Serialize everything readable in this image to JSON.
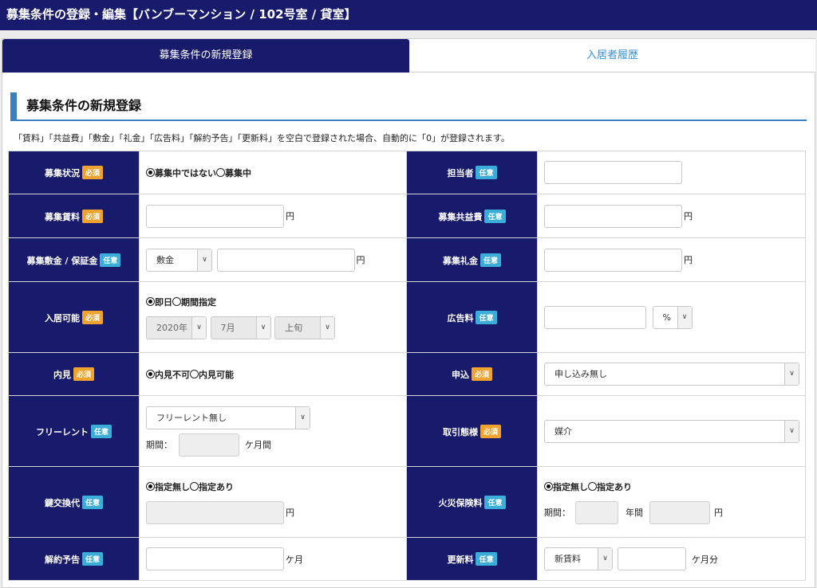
{
  "header": {
    "title": "募集条件の登録・編集【バンブーマンション / 102号室 / 貸室】"
  },
  "tabs": [
    {
      "label": "募集条件の新規登録"
    },
    {
      "label": "入居者履歴"
    }
  ],
  "section": {
    "title": "募集条件の新規登録",
    "note": "「賃料」「共益費」「敷金」「礼金」「広告料」「解約予告」「更新料」を空白で登録された場合、自動的に「0」が登録されます。"
  },
  "badges": {
    "required": "必須",
    "optional": "任意"
  },
  "fields": {
    "status": {
      "label": "募集状況",
      "options": [
        "募集中ではない",
        "募集中"
      ]
    },
    "tanto": {
      "label": "担当者"
    },
    "rent": {
      "label": "募集賃料",
      "unit": "円"
    },
    "common": {
      "label": "募集共益費",
      "unit": "円"
    },
    "deposit": {
      "label": "募集敷金 / 保証金",
      "select": "敷金",
      "unit": "円"
    },
    "keymoney": {
      "label": "募集礼金",
      "unit": "円"
    },
    "movein": {
      "label": "入居可能",
      "options": [
        "即日",
        "期間指定"
      ],
      "year": "2020年",
      "month": "7月",
      "period": "上旬"
    },
    "adfee": {
      "label": "広告料",
      "select": "%"
    },
    "viewing": {
      "label": "内見",
      "options": [
        "内見不可",
        "内見可能"
      ]
    },
    "application": {
      "label": "申込",
      "select": "申し込み無し"
    },
    "freerent": {
      "label": "フリーレント",
      "select": "フリーレント無し",
      "period_label": "期間：",
      "unit": "ケ月間"
    },
    "transaction": {
      "label": "取引態様",
      "select": "媒介"
    },
    "keychange": {
      "label": "鍵交換代",
      "options": [
        "指定無し",
        "指定あり"
      ],
      "unit": "円"
    },
    "fireins": {
      "label": "火災保険料",
      "options": [
        "指定無し",
        "指定あり"
      ],
      "period_label": "期間：",
      "year_unit": "年間",
      "unit": "円"
    },
    "notice": {
      "label": "解約予告",
      "unit": "ケ月"
    },
    "renewal": {
      "label": "更新料",
      "select": "新賃料",
      "unit": "ケ月分"
    }
  }
}
